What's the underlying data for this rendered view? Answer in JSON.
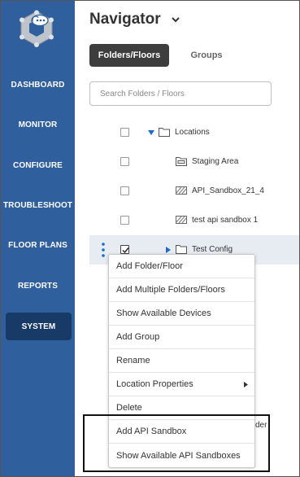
{
  "sidebar": {
    "items": [
      {
        "label": "DASHBOARD"
      },
      {
        "label": "MONITOR"
      },
      {
        "label": "CONFIGURE"
      },
      {
        "label": "TROUBLESHOOT"
      },
      {
        "label": "FLOOR PLANS"
      },
      {
        "label": "REPORTS"
      },
      {
        "label": "SYSTEM",
        "active": true
      }
    ]
  },
  "header": {
    "title": "Navigator"
  },
  "tabs": [
    {
      "label": "Folders/Floors",
      "active": true
    },
    {
      "label": "Groups"
    }
  ],
  "search": {
    "placeholder": "Search Folders / Floors"
  },
  "tree": {
    "rows": [
      {
        "label": "Locations",
        "icon": "folder-icon",
        "expanded": true
      },
      {
        "label": "Staging Area",
        "icon": "staging-folder-icon"
      },
      {
        "label": "API_Sandbox_21_4",
        "icon": "sandbox-icon"
      },
      {
        "label": "test api sandbox 1",
        "icon": "sandbox-icon"
      },
      {
        "label": "Test Config",
        "icon": "folder-icon",
        "checked": true,
        "selected": true
      }
    ]
  },
  "context_menu": {
    "items": [
      {
        "label": "Add Folder/Floor"
      },
      {
        "label": "Add Multiple Folders/Floors"
      },
      {
        "label": "Show Available Devices"
      },
      {
        "label": "Add Group"
      },
      {
        "label": "Rename"
      },
      {
        "label": "Location Properties",
        "submenu": true
      },
      {
        "label": "Delete"
      },
      {
        "label": "Add API Sandbox"
      },
      {
        "label": "Show Available API Sandboxes"
      }
    ]
  },
  "behind_text": "der",
  "colors": {
    "sidebar_bg": "#2f5f9c",
    "sidebar_active_bg": "#173a66",
    "tab_active_bg": "#3d3d3d",
    "selected_row_bg": "#e7ebf2",
    "accent_blue": "#1e6bc6"
  }
}
